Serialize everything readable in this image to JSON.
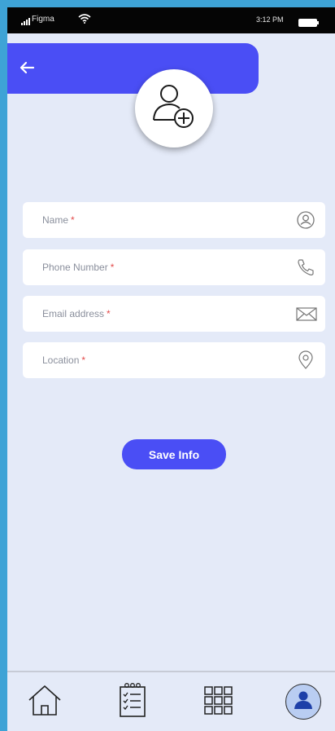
{
  "status_bar": {
    "carrier": "Figma",
    "time": "3:12 PM",
    "icons": [
      "signal-icon",
      "wifi-icon",
      "battery-icon"
    ]
  },
  "header": {
    "back_icon": "arrow-left-icon",
    "avatar_icon": "user-add-icon",
    "color": "#4a4ef5"
  },
  "form": {
    "fields": [
      {
        "label": "Name",
        "required_mark": "*",
        "icon": "user-circle-icon"
      },
      {
        "label": "Phone Number",
        "required_mark": "*",
        "icon": "phone-icon"
      },
      {
        "label": "Email address",
        "required_mark": "*",
        "icon": "envelope-icon"
      },
      {
        "label": "Location",
        "required_mark": "*",
        "icon": "location-pin-icon"
      }
    ]
  },
  "save_button": {
    "label": "Save Info"
  },
  "bottom_nav": {
    "items": [
      {
        "name": "home",
        "icon": "home-icon"
      },
      {
        "name": "tasks",
        "icon": "checklist-icon"
      },
      {
        "name": "apps",
        "icon": "grid-icon"
      },
      {
        "name": "profile",
        "icon": "profile-icon",
        "active": true
      }
    ]
  },
  "colors": {
    "accent": "#4a4ef5",
    "background": "#e4eaf8",
    "required": "#e34b4b",
    "frame": "#3ea3d6"
  }
}
